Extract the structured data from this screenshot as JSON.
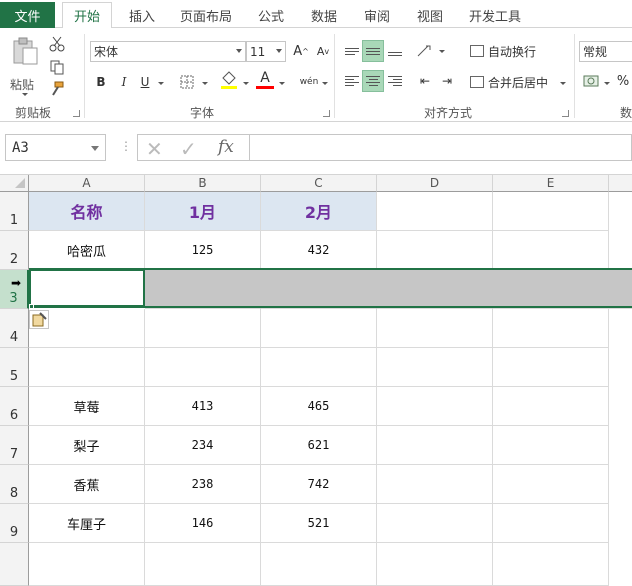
{
  "tabs": {
    "file": "文件",
    "items": [
      "开始",
      "插入",
      "页面布局",
      "公式",
      "数据",
      "审阅",
      "视图",
      "开发工具"
    ],
    "active": "开始"
  },
  "ribbon": {
    "clipboard": {
      "paste": "粘贴",
      "label": "剪贴板"
    },
    "font": {
      "name": "宋体",
      "size": "11",
      "bold": "B",
      "italic": "I",
      "underline": "U",
      "font_color_glyph": "A",
      "grow": "A",
      "shrink": "A",
      "phonetic": "wén",
      "label": "字体"
    },
    "alignment": {
      "wrap": "自动换行",
      "merge": "合并后居中",
      "label": "对齐方式"
    },
    "number": {
      "format": "常规",
      "percent": "%",
      "label": "数"
    },
    "colors": {
      "accent": "#217346",
      "fill_yellow": "#ffff00",
      "font_red": "#ff0000"
    }
  },
  "formula_bar": {
    "name_box": "A3",
    "fx": "fx",
    "value": ""
  },
  "grid": {
    "columns": [
      "A",
      "B",
      "C",
      "D",
      "E"
    ],
    "rows": [
      "1",
      "2",
      "3",
      "4",
      "5",
      "6",
      "7",
      "8",
      "9",
      ""
    ],
    "cells": {
      "r1": [
        "名称",
        "1月",
        "2月"
      ],
      "r2": [
        "哈密瓜",
        "125",
        "432"
      ],
      "r6": [
        "草莓",
        "413",
        "465"
      ],
      "r7": [
        "梨子",
        "234",
        "621"
      ],
      "r8": [
        "香蕉",
        "238",
        "742"
      ],
      "r9": [
        "车厘子",
        "146",
        "521"
      ]
    },
    "selected_row": "3"
  }
}
